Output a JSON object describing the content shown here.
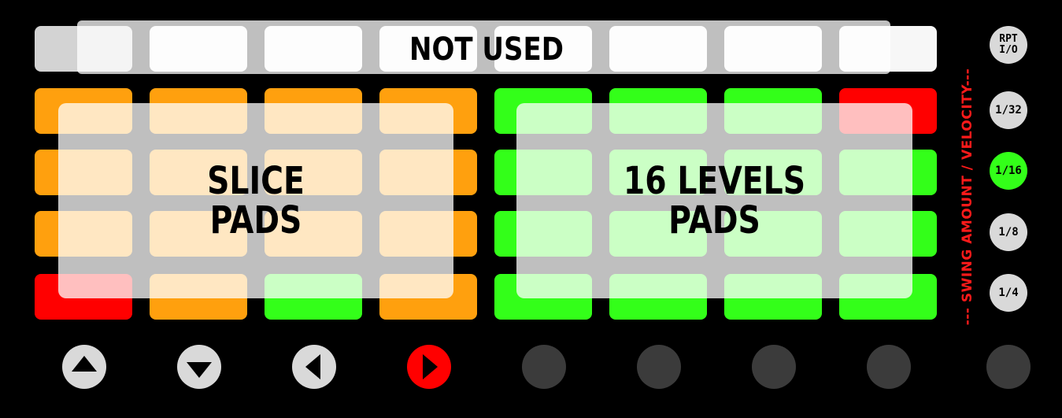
{
  "top_label": "NOT USED",
  "slice_overlay_label": "SLICE\nPADS",
  "levels_overlay_label": "16 LEVELS\nPADS",
  "side_label": "--- SWING AMOUNT / VELOCITY---",
  "side_buttons": [
    {
      "label": "RPT\nI/O",
      "active": false
    },
    {
      "label": "1/32",
      "active": false
    },
    {
      "label": "1/16",
      "active": true
    },
    {
      "label": "1/8",
      "active": false
    },
    {
      "label": "1/4",
      "active": false
    }
  ],
  "pad_grid": [
    [
      "orange",
      "orange",
      "orange",
      "orange",
      "green",
      "green",
      "green",
      "red"
    ],
    [
      "orange",
      "orange",
      "orange",
      "orange",
      "green",
      "green",
      "green",
      "green"
    ],
    [
      "orange",
      "orange",
      "orange",
      "orange",
      "green",
      "green",
      "green",
      "green"
    ],
    [
      "red",
      "orange",
      "green",
      "orange",
      "green",
      "green",
      "green",
      "green"
    ]
  ],
  "nav_buttons": [
    {
      "icon": "up-arrow-icon",
      "state": "light"
    },
    {
      "icon": "down-arrow-icon",
      "state": "light"
    },
    {
      "icon": "left-arrow-icon",
      "state": "light"
    },
    {
      "icon": "right-arrow-icon",
      "state": "red"
    },
    {
      "icon": "",
      "state": "dark"
    },
    {
      "icon": "",
      "state": "dark"
    },
    {
      "icon": "",
      "state": "dark"
    },
    {
      "icon": "",
      "state": "dark"
    },
    {
      "icon": "",
      "state": "dark"
    }
  ],
  "colors": {
    "orange": "#ffa00e",
    "green": "#33ff19",
    "red": "#ff0000",
    "light_pad": "#f7f7f7",
    "side_label": "#ff1a1a"
  }
}
